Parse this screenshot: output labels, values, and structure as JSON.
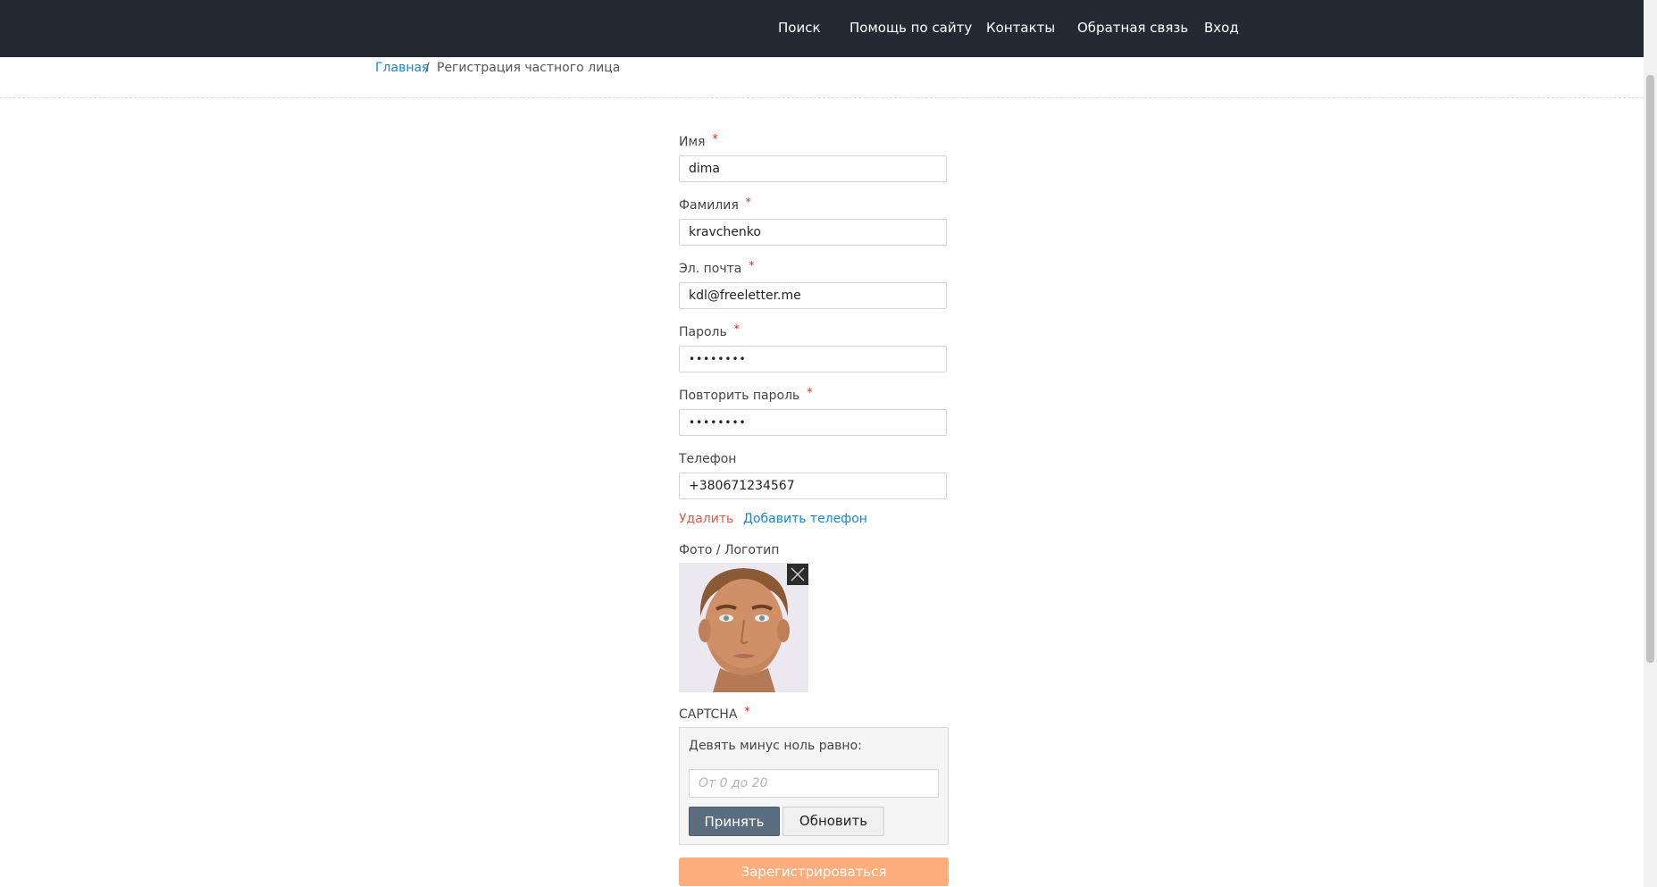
{
  "nav": {
    "items": [
      "Поиск",
      "Помощь по сайту",
      "Контакты",
      "Обратная связь",
      "Вход"
    ]
  },
  "breadcrumb": {
    "home": "Главная",
    "separator": "/",
    "current": "Регистрация частного лица"
  },
  "form": {
    "required_mark": "*",
    "first_name": {
      "label": "Имя",
      "value": "dima"
    },
    "last_name": {
      "label": "Фамилия",
      "value": "kravchenko"
    },
    "email": {
      "label": "Эл. почта",
      "value": "kdl@freeletter.me"
    },
    "password": {
      "label": "Пароль",
      "value": "••••••••"
    },
    "password_repeat": {
      "label": "Повторить пароль",
      "value": "••••••••"
    },
    "phone": {
      "label": "Телефон",
      "value": "+380671234567"
    },
    "delete_link": "Удалить",
    "add_phone_link": "Добавить телефон",
    "photo": {
      "label": "Фото / Логотип"
    },
    "captcha": {
      "label": "CAPTCHA",
      "question": "Девять минус ноль равно:",
      "placeholder": "От 0 до 20",
      "accept_label": "Принять",
      "refresh_label": "Обновить"
    },
    "register_label": "Зарегистрироваться"
  },
  "colors": {
    "header_bg": "#222b33",
    "link": "#1a86c8",
    "delete": "#e05a48",
    "required": "#e0261c",
    "register_button": "#fdae7c",
    "accept_button": "#5b6e7f"
  }
}
